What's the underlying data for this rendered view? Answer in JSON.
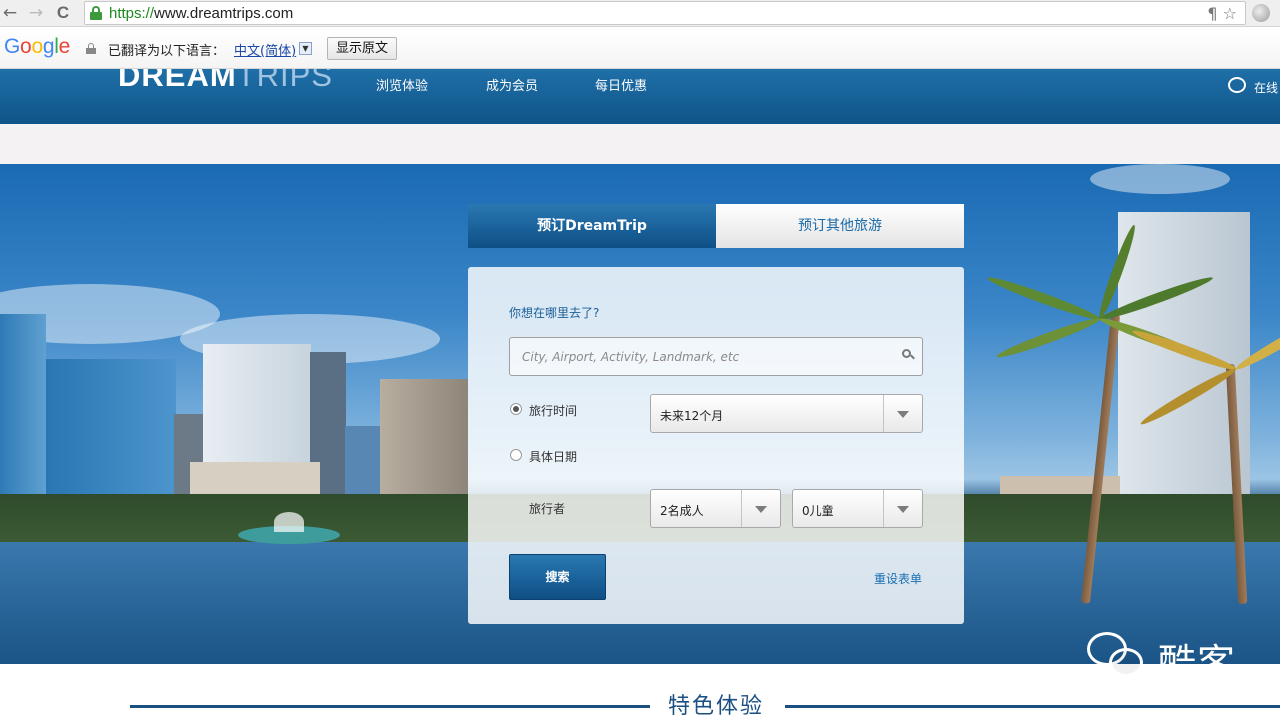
{
  "browser": {
    "back_glyph": "←",
    "forward_glyph": "→",
    "reload_glyph": "C",
    "url_scheme": "https://",
    "url_rest": "www.dreamtrips.com",
    "tools_glyph": "¶ ☆"
  },
  "translate_bar": {
    "logo_letters": [
      "G",
      "o",
      "o",
      "g",
      "l",
      "e"
    ],
    "message": "已翻译为以下语言：",
    "language": "中文(简体)",
    "dropdown_glyph": "▼",
    "show_original_button": "显示原文"
  },
  "site": {
    "logo_bold": "DREAM",
    "logo_light": "TRIPS",
    "nav": [
      "浏览体验",
      "成为会员",
      "每日优惠"
    ],
    "chat_label": "在线",
    "colors": {
      "header": "#1f6fa8",
      "accent": "#1b6fb0",
      "button": "#0e4f85"
    }
  },
  "booking": {
    "tabs": [
      "预订DreamTrip",
      "预订其他旅游"
    ],
    "active_tab": 0,
    "destination_label": "你想在哪里去了?",
    "destination_placeholder": "City, Airport, Activity, Landmark, etc",
    "travel_time_label": "旅行时间",
    "travel_time_value": "未来12个月",
    "specific_date_label": "具体日期",
    "travelers_label": "旅行者",
    "adults_value": "2名成人",
    "children_value": "0儿童",
    "search_button": "搜索",
    "reset_link": "重设表单"
  },
  "featured": {
    "title": "特色体验"
  },
  "watermark": {
    "icon": "wechat-icon",
    "text": "酷客"
  }
}
